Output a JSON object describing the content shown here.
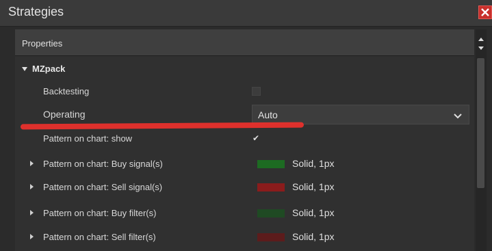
{
  "window": {
    "title": "Strategies"
  },
  "panel": {
    "header": "Properties",
    "group": {
      "label": "MZpack",
      "expanded": true
    },
    "rows": {
      "backtesting": {
        "label": "Backtesting",
        "checked": false
      },
      "operating": {
        "label": "Operating",
        "value": "Auto"
      },
      "pattern_show": {
        "label": "Pattern on chart: show",
        "checked": true
      },
      "buy_signals": {
        "label": "Pattern on chart: Buy signal(s)",
        "style": "Solid, 1px",
        "color": "#1d6b22"
      },
      "sell_signals": {
        "label": "Pattern on chart: Sell signal(s)",
        "style": "Solid, 1px",
        "color": "#8a1c1c"
      },
      "buy_filters": {
        "label": "Pattern on chart: Buy filter(s)",
        "style": "Solid, 1px",
        "color": "#1f4a23"
      },
      "sell_filters": {
        "label": "Pattern on chart: Sell filter(s)",
        "style": "Solid, 1px",
        "color": "#5c1c1c"
      }
    }
  },
  "colors": {
    "highlight_stroke": "#e8302c",
    "close_button": "#c8302c"
  }
}
